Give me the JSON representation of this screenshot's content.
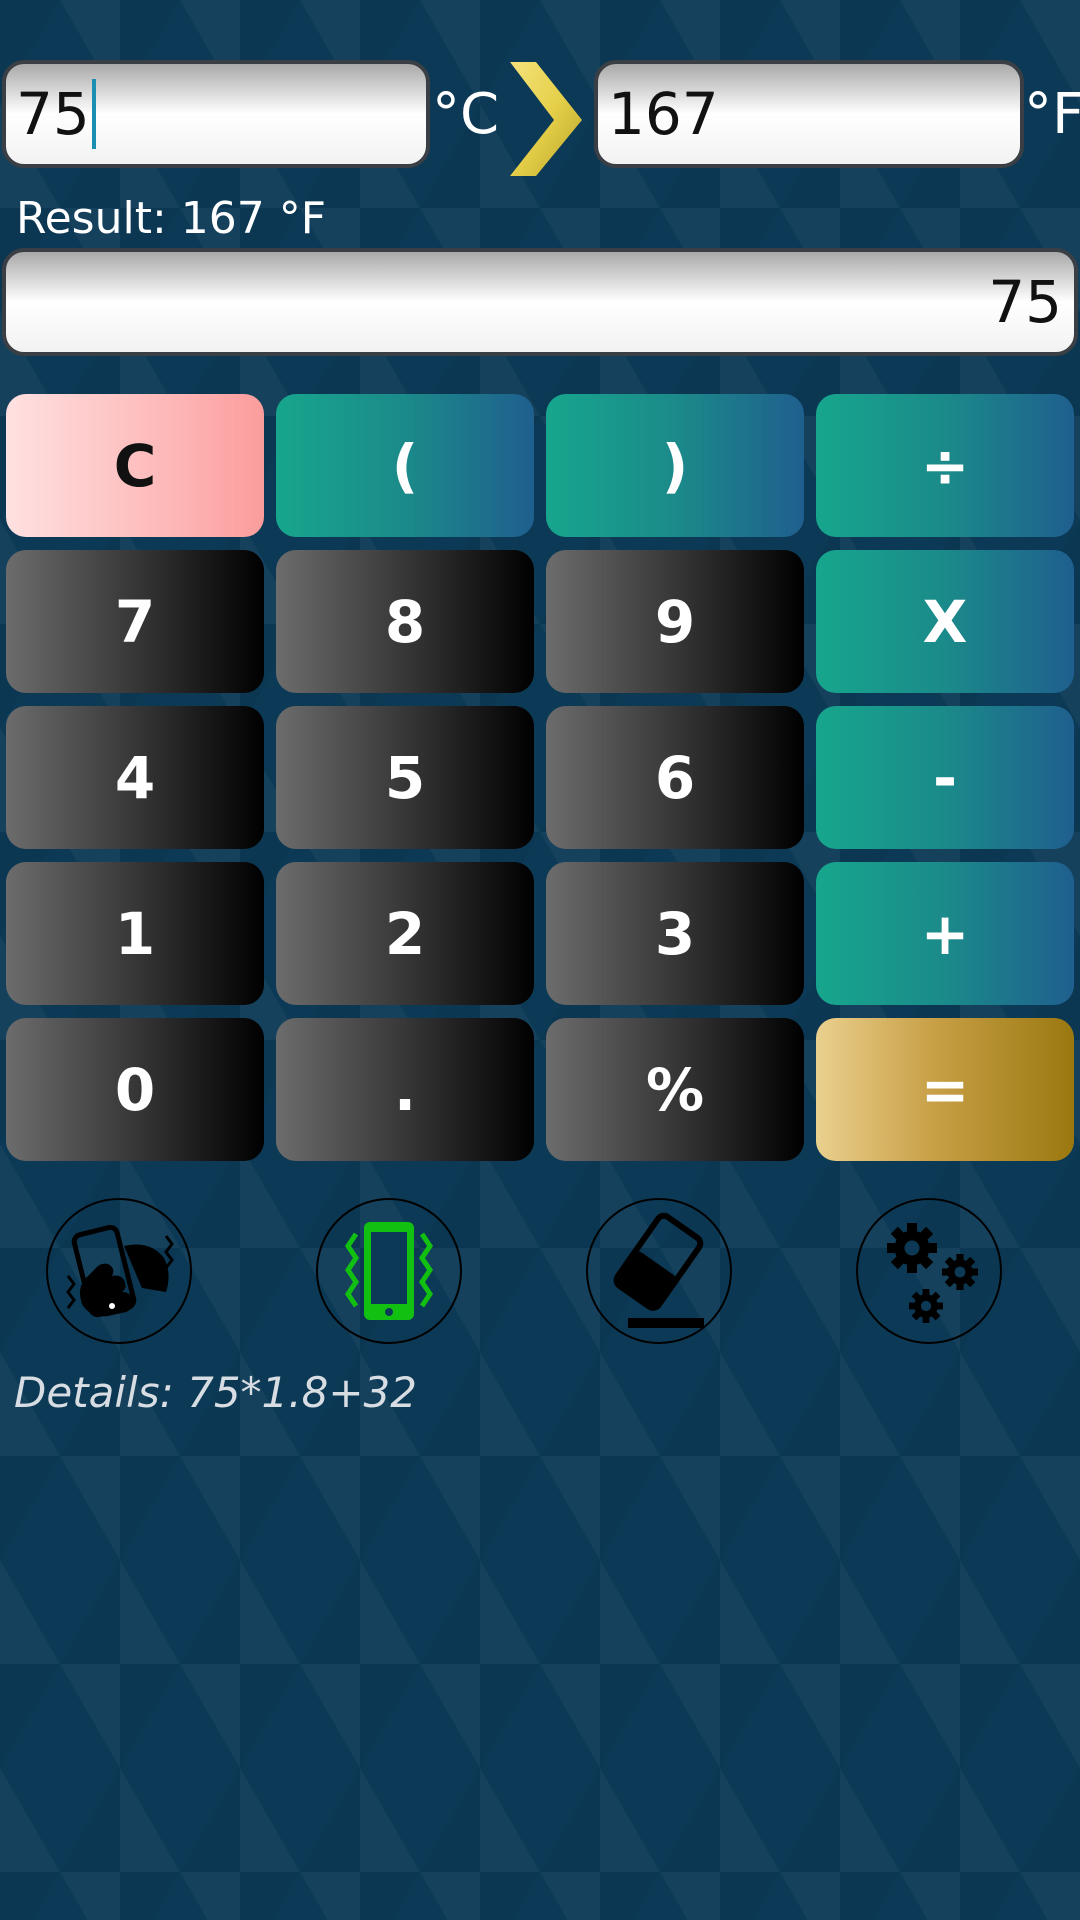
{
  "converter": {
    "from_value": "75",
    "from_unit": "°C",
    "to_value": "167",
    "to_unit": "°F"
  },
  "result_label": "Result: 167 °F",
  "display_value": "75",
  "keypad": {
    "clear": "C",
    "open_paren": "(",
    "close_paren": ")",
    "divide": "÷",
    "seven": "7",
    "eight": "8",
    "nine": "9",
    "multiply": "X",
    "four": "4",
    "five": "5",
    "six": "6",
    "minus": "-",
    "one": "1",
    "two": "2",
    "three": "3",
    "plus": "+",
    "zero": "0",
    "decimal": ".",
    "percent": "%",
    "equals": "="
  },
  "tools": {
    "shake_icon": "shake-phone-icon",
    "vibrate_icon": "vibrate-phone-icon",
    "eraser_icon": "eraser-icon",
    "settings_icon": "gears-icon",
    "vibrate_color": "#12c012"
  },
  "details": "Details: 75*1.8+32",
  "colors": {
    "background": "#0c3a56",
    "clear_key": "#fdb3b3",
    "operator_key": "#17a68d",
    "equals_key": "#c8a047",
    "arrow": "#e6d04a"
  }
}
